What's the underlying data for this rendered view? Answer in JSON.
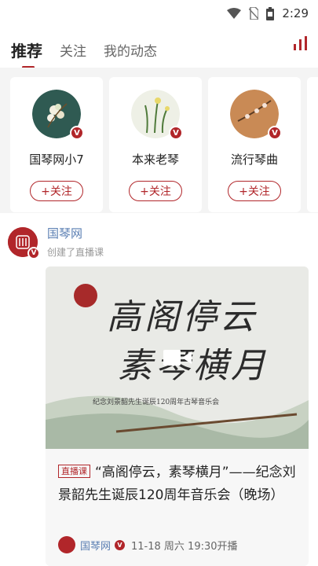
{
  "status_bar": {
    "time": "2:29"
  },
  "tabs": [
    {
      "label": "推荐",
      "active": true
    },
    {
      "label": "关注",
      "active": false
    },
    {
      "label": "我的动态",
      "active": false
    }
  ],
  "recommend": [
    {
      "name": "国琴网小7",
      "follow_label": "+关注"
    },
    {
      "name": "本来老琴",
      "follow_label": "+关注"
    },
    {
      "name": "流行琴曲",
      "follow_label": "+关注"
    }
  ],
  "feed": {
    "author": "国琴网",
    "action": "创建了直播课",
    "verified_mark": "V",
    "post": {
      "cover_line1": "高阁停云",
      "cover_line2": "素琴横月",
      "cover_sub": "纪念刘景韶先生诞辰120周年古琴音乐会",
      "tag": "直播课",
      "title": "“高阁停云，素琴横月”——纪念刘景韶先生诞辰120周年音乐会（晚场）",
      "meta_author": "国琴网",
      "meta_time": "11-18 周六 19:30开播"
    }
  },
  "colors": {
    "accent": "#b1262a",
    "link": "#5b7fb3"
  }
}
